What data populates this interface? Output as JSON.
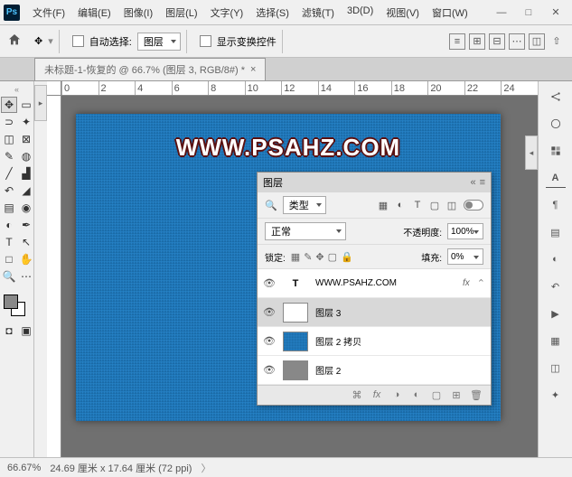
{
  "menu": {
    "file": "文件(F)",
    "edit": "编辑(E)",
    "image": "图像(I)",
    "layer": "图层(L)",
    "type": "文字(Y)",
    "select": "选择(S)",
    "filter": "滤镜(T)",
    "threed": "3D(D)",
    "view": "视图(V)",
    "window": "窗口(W)"
  },
  "optbar": {
    "auto_select": "自动选择:",
    "target": "图层",
    "show_transform": "显示变换控件"
  },
  "doctab": {
    "title": "未标题-1-恢复的 @ 66.7% (图层 3, RGB/8#) *",
    "close": "×"
  },
  "ruler_h": [
    "0",
    "2",
    "4",
    "6",
    "8",
    "10",
    "12",
    "14",
    "16",
    "18",
    "20",
    "22",
    "24"
  ],
  "canvas_text": "WWW.PSAHZ.COM",
  "status": {
    "zoom": "66.67%",
    "dims": "24.69 厘米 x 17.64 厘米 (72 ppi)"
  },
  "layers_panel": {
    "title": "图层",
    "kind_label": "类型",
    "blend": "正常",
    "opacity_label": "不透明度:",
    "opacity": "100%",
    "lock_label": "锁定:",
    "fill_label": "填充:",
    "fill": "0%",
    "layers": [
      {
        "name": "WWW.PSAHZ.COM",
        "type": "T",
        "fx": "fx"
      },
      {
        "name": "图层 3",
        "type": "thumb",
        "sel": true
      },
      {
        "name": "图层 2 拷贝",
        "type": "denim"
      },
      {
        "name": "图层 2",
        "type": "gray"
      }
    ]
  }
}
